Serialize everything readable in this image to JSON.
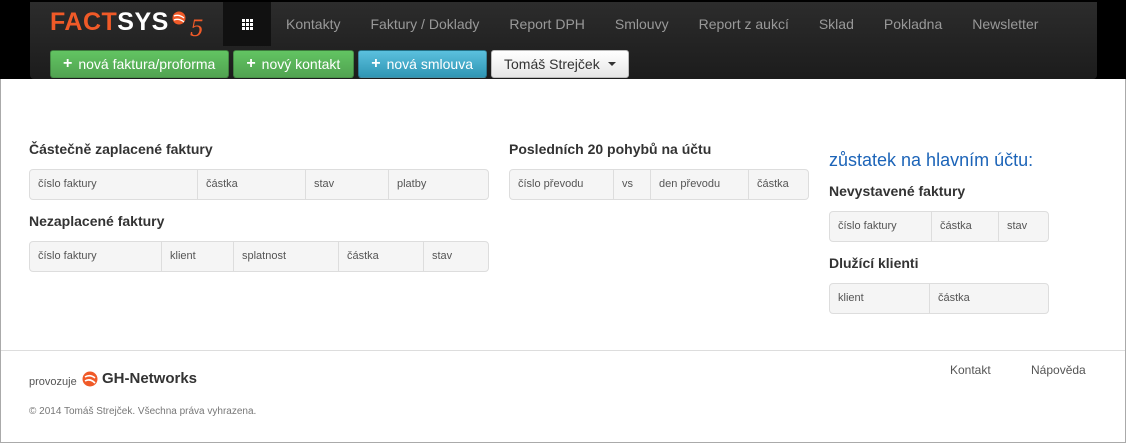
{
  "brand": {
    "name_a": "FACT",
    "name_b": "SYS",
    "version": "5"
  },
  "nav": {
    "items": [
      "Kontakty",
      "Faktury / Doklady",
      "Report DPH",
      "Smlouvy",
      "Report z aukcí",
      "Sklad",
      "Pokladna",
      "Newsletter"
    ]
  },
  "actions": {
    "new_invoice": "nová faktura/proforma",
    "new_contact": "nový kontakt",
    "new_contract": "nová smlouva",
    "user": "Tomáš Strejček"
  },
  "sections": {
    "partial": {
      "title": "Částečně zaplacené faktury",
      "columns": [
        "číslo faktury",
        "částka",
        "stav",
        "platby"
      ]
    },
    "unpaid": {
      "title": "Nezaplacené faktury",
      "columns": [
        "číslo faktury",
        "klient",
        "splatnost",
        "částka",
        "stav"
      ]
    },
    "movements": {
      "title": "Posledních 20 pohybů na účtu",
      "columns": [
        "číslo převodu",
        "vs",
        "den převodu",
        "částka"
      ]
    },
    "balance": {
      "title": "zůstatek na hlavním účtu:"
    },
    "unissued": {
      "title": "Nevystavené faktury",
      "columns": [
        "číslo faktury",
        "částka",
        "stav"
      ]
    },
    "debtors": {
      "title": "Dlužící klienti",
      "columns": [
        "klient",
        "částka"
      ]
    }
  },
  "footer": {
    "operated_by": "provozuje",
    "company": "GH-Networks",
    "copyright": "© 2014 Tomáš Strejček. Všechna práva vyhrazena.",
    "links": [
      "Kontakt",
      "Nápověda"
    ]
  },
  "colors": {
    "brand_orange": "#f05a28",
    "success_green": "#5bb75b",
    "info_blue": "#49afcd",
    "balance_blue": "#1c64b8"
  },
  "icons": {
    "apps": "grid-icon",
    "plus": "plus-icon",
    "caret": "caret-down-icon"
  }
}
